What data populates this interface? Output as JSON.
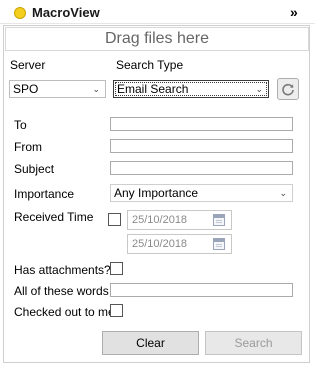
{
  "app": {
    "title": "MacroView"
  },
  "dropzone": {
    "text": "Drag files here"
  },
  "server": {
    "label": "Server",
    "value": "SPO"
  },
  "search_type": {
    "label": "Search Type",
    "value": "Email Search"
  },
  "fields": {
    "to": {
      "label": "To",
      "value": ""
    },
    "from": {
      "label": "From",
      "value": ""
    },
    "subject": {
      "label": "Subject",
      "value": ""
    },
    "importance": {
      "label": "Importance",
      "value": "Any Importance"
    },
    "received_time": {
      "label": "Received Time",
      "checked": false,
      "date_from": "25/10/2018",
      "date_to": "25/10/2018"
    },
    "has_attachments": {
      "label": "Has attachments?",
      "checked": false
    },
    "all_words": {
      "label": "All of these words",
      "value": ""
    },
    "checked_out": {
      "label": "Checked out to me",
      "checked": false
    }
  },
  "buttons": {
    "clear": "Clear",
    "search": "Search"
  },
  "icons": {
    "app_logo": "macroview-logo",
    "collapse": "double-chevron-right-icon",
    "refresh": "refresh-icon",
    "calendar": "calendar-icon"
  },
  "colors": {
    "logo": "#f5cf1e",
    "panel_border": "#cfcfcf",
    "button_bg": "#e1e1e1",
    "disabled_text": "#9a9a9a"
  }
}
